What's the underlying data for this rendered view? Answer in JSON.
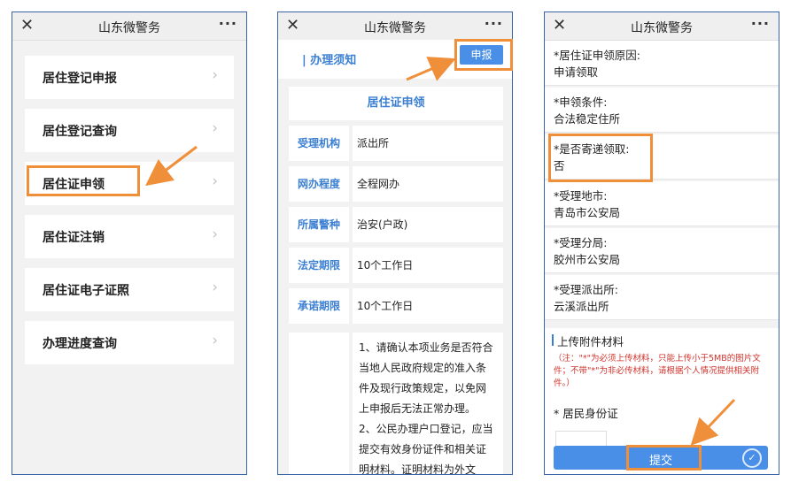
{
  "app_title": "山东微警务",
  "close_glyph": "✕",
  "more_glyph": "···",
  "chevron_glyph": "›",
  "accent_color": "#3b7fd3",
  "highlight_color": "#ef8f3a",
  "screen1": {
    "menu": [
      {
        "label": "居住登记申报"
      },
      {
        "label": "居住登记查询"
      },
      {
        "label": "居住证申领"
      },
      {
        "label": "居住证注销"
      },
      {
        "label": "居住证电子证照"
      },
      {
        "label": "办理进度查询"
      }
    ]
  },
  "screen2": {
    "notice_title": "| 办理须知",
    "apply_button": "申报",
    "card_title": "居住证申领",
    "rows": [
      {
        "key": "受理机构",
        "value": "派出所"
      },
      {
        "key": "网办程度",
        "value": "全程网办"
      },
      {
        "key": "所属警种",
        "value": "治安(户政)"
      },
      {
        "key": "法定期限",
        "value": "10个工作日"
      },
      {
        "key": "承诺期限",
        "value": "10个工作日"
      }
    ],
    "notes": [
      "1、请确认本项业务是否符合",
      "当地人民政府规定的准入条",
      "件及现行政策规定，以免网",
      "上申报后无法正常办理。",
      "2、公民办理户口登记，应当",
      "提交有效身份证件和相关证",
      "明材料。证明材料为外文"
    ]
  },
  "screen3": {
    "fields": [
      {
        "label": "*居住证申领原因:",
        "value": "申请领取"
      },
      {
        "label": "*申领条件:",
        "value": "合法稳定住所"
      },
      {
        "label": "*是否寄递领取:",
        "value": "否"
      },
      {
        "label": "*受理地市:",
        "value": "青岛市公安局"
      },
      {
        "label": "*受理分局:",
        "value": "胶州市公安局"
      },
      {
        "label": "*受理派出所:",
        "value": "云溪派出所"
      }
    ],
    "upload_title": "上传附件材料",
    "upload_note": "（注：\"*\"为必须上传材料，只能上传小于5MB的图片文件；不带\"*\"为非必传材料，请根据个人情况提供相关附件。）",
    "id_card_label": "* 居民身份证",
    "submit_button": "提交"
  }
}
